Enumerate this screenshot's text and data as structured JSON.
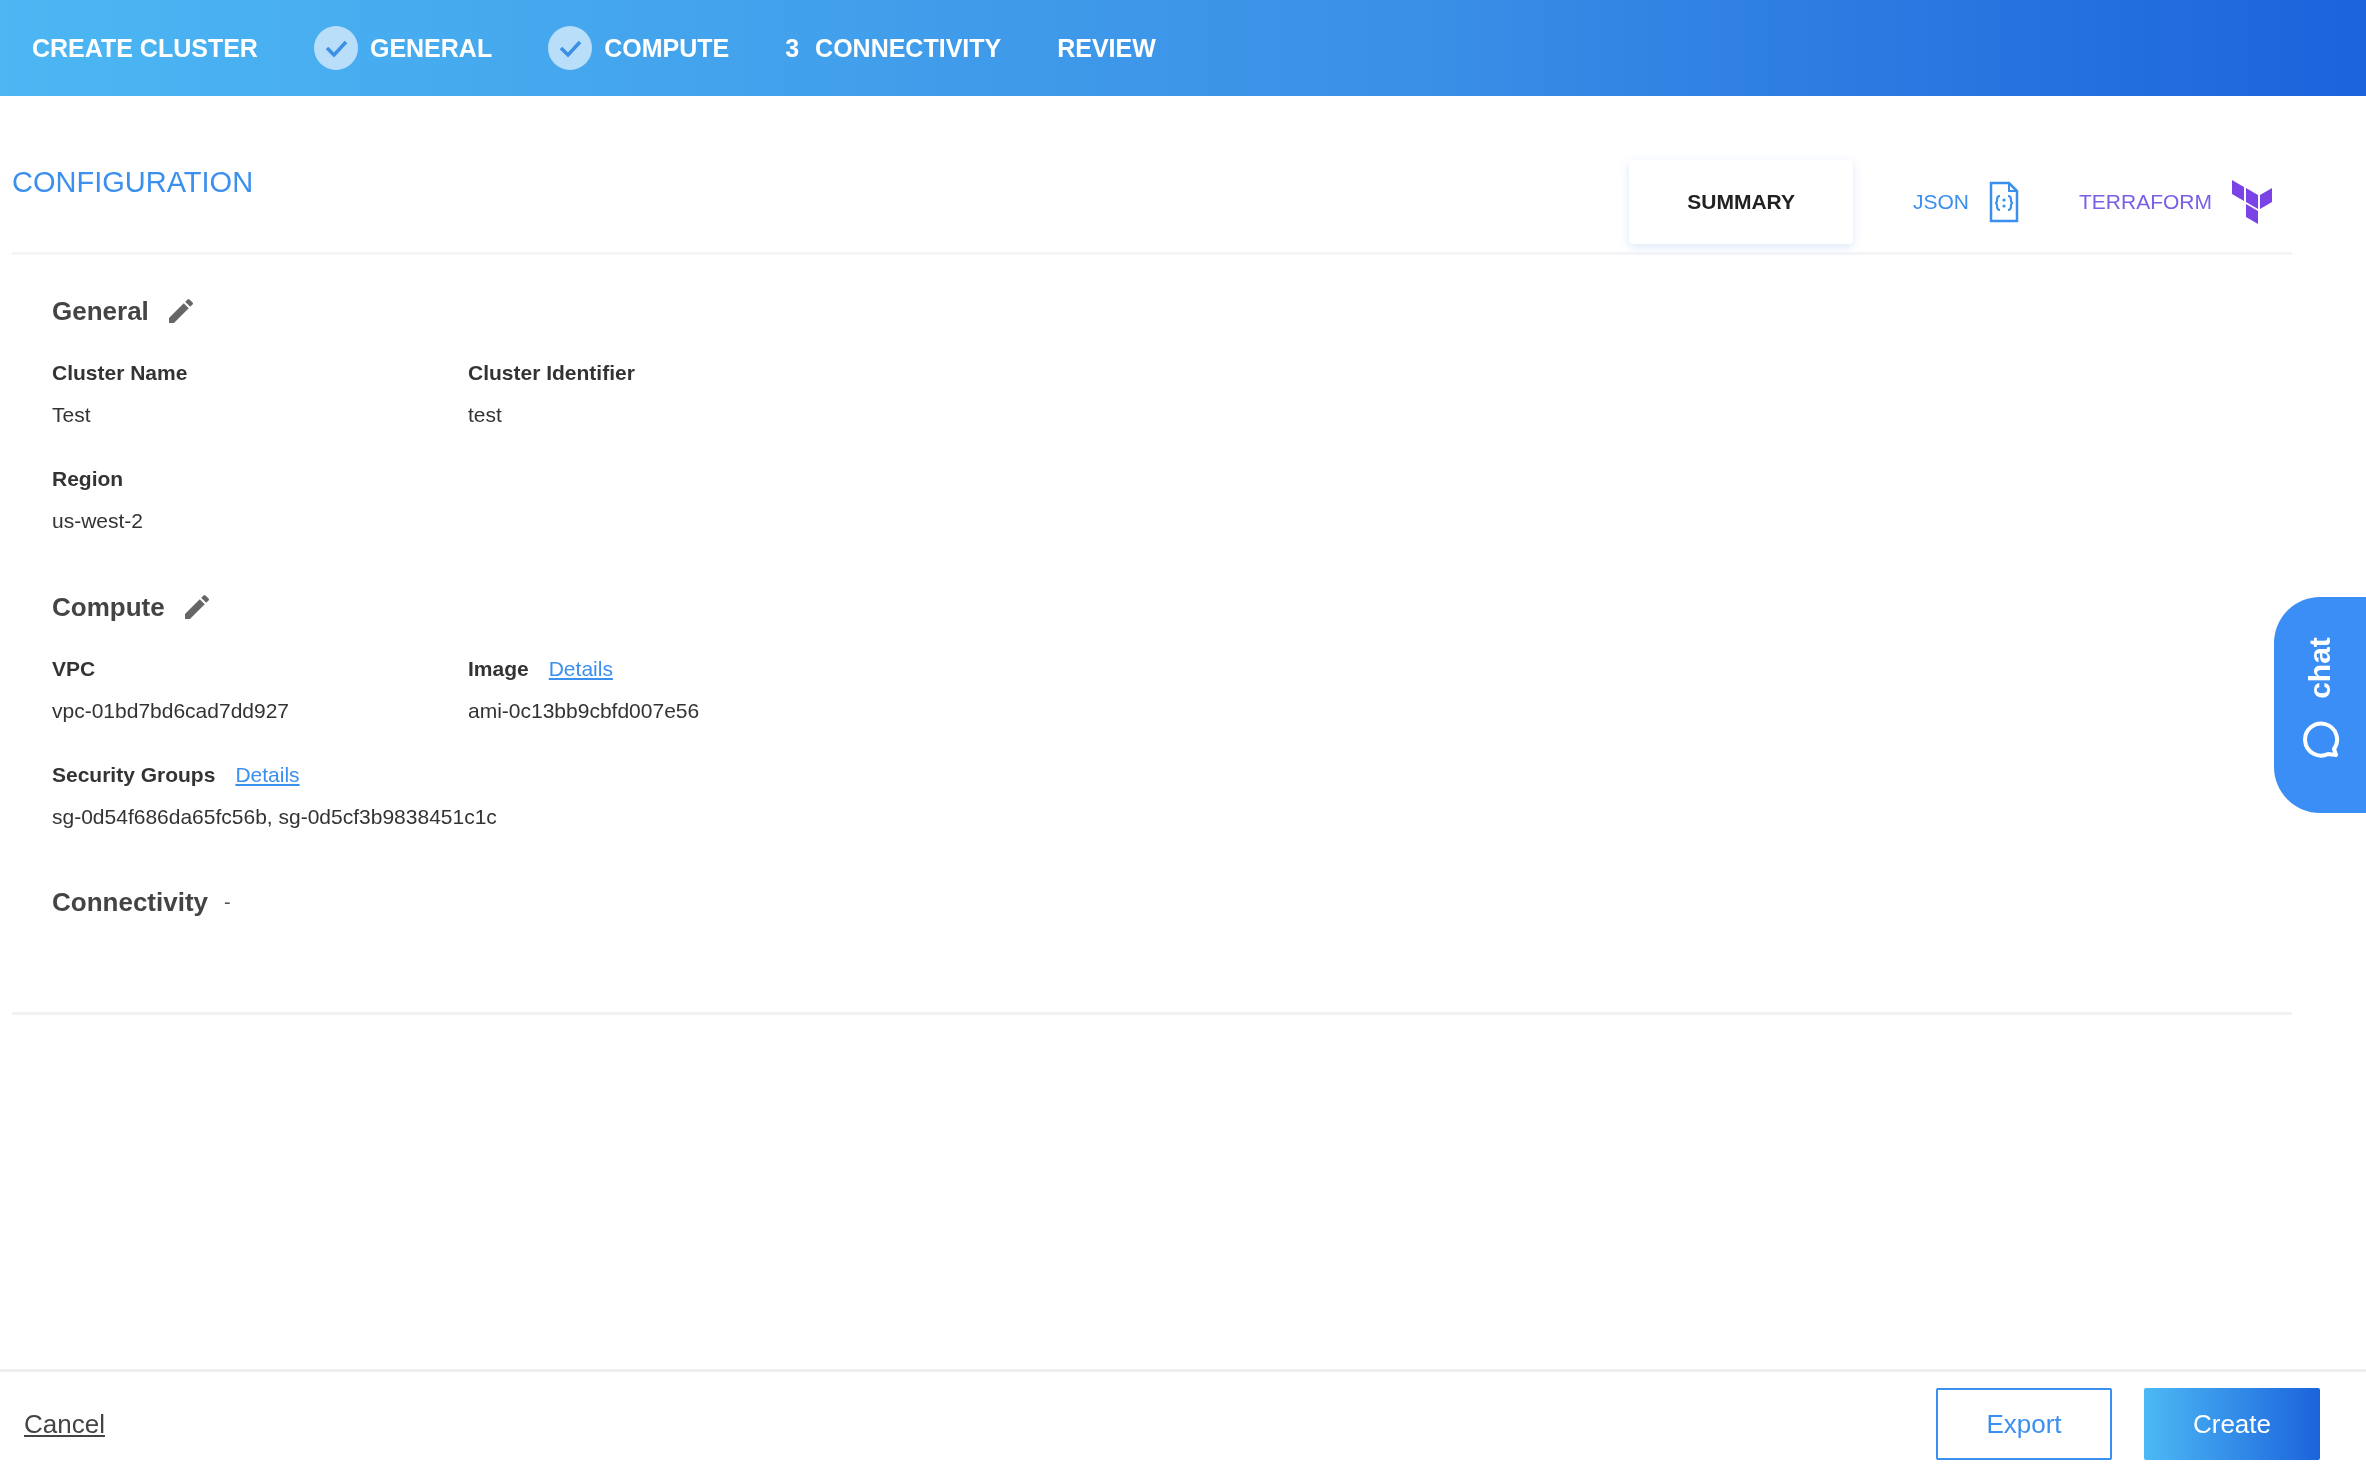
{
  "header": {
    "title": "CREATE CLUSTER",
    "steps": [
      {
        "label": "GENERAL",
        "kind": "done"
      },
      {
        "label": "COMPUTE",
        "kind": "done"
      },
      {
        "label": "CONNECTIVITY",
        "kind": "numbered",
        "number": "3"
      },
      {
        "label": "REVIEW",
        "kind": "plain"
      }
    ]
  },
  "configuration": {
    "title": "CONFIGURATION",
    "tabs": [
      {
        "label": "SUMMARY",
        "selected": true,
        "kind": "plain"
      },
      {
        "label": "JSON",
        "selected": false,
        "kind": "json"
      },
      {
        "label": "TERRAFORM",
        "selected": false,
        "kind": "terraform"
      }
    ],
    "sections": [
      {
        "title": "General",
        "editable": true,
        "fields": [
          {
            "label": "Cluster Name",
            "value": "Test"
          },
          {
            "label": "Cluster Identifier",
            "value": "test"
          },
          {
            "label": "Region",
            "value": "us-west-2"
          }
        ]
      },
      {
        "title": "Compute",
        "editable": true,
        "fields": [
          {
            "label": "VPC",
            "value": "vpc-01bd7bd6cad7dd927"
          },
          {
            "label": "Image",
            "link": "Details",
            "value": "ami-0c13bb9cbfd007e56"
          },
          {
            "label": "Security Groups",
            "link": "Details",
            "value": "sg-0d54f686da65fc56b, sg-0d5cf3b9838451c1c"
          }
        ]
      },
      {
        "title": "Connectivity",
        "editable": false,
        "note": "-"
      }
    ]
  },
  "chat": {
    "label": "chat"
  },
  "footer": {
    "cancel": "Cancel",
    "buttons": [
      {
        "label": "Export",
        "kind": "outline"
      },
      {
        "label": "Create",
        "kind": "primary"
      }
    ]
  }
}
